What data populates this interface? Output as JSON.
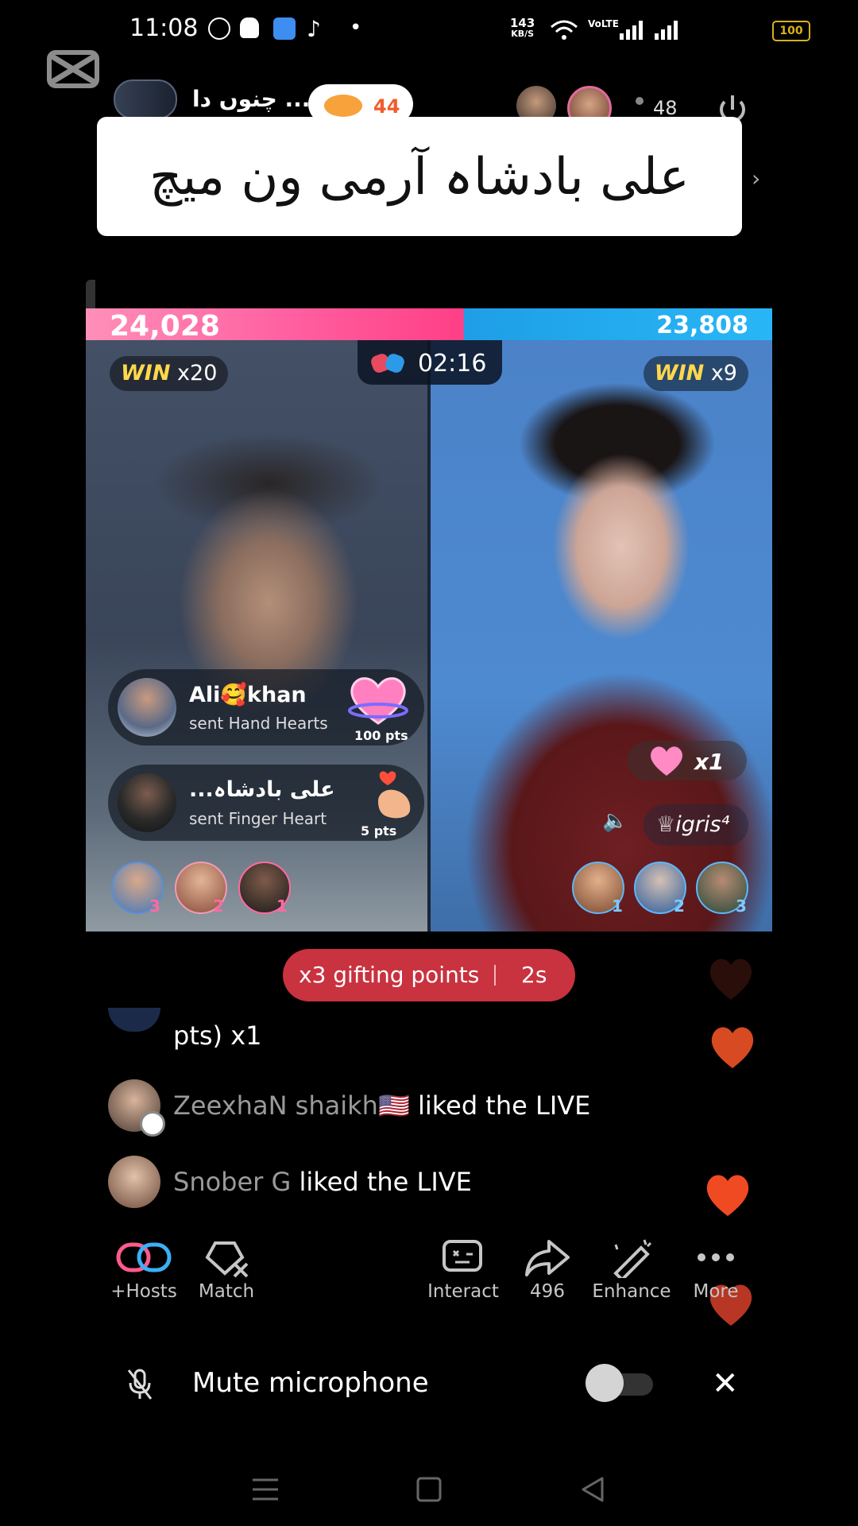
{
  "status_bar": {
    "time": "11:08",
    "net_speed_value": "143",
    "net_speed_unit": "KB/S",
    "volte": "VoLTE",
    "battery": "100",
    "dot": "•"
  },
  "header": {
    "host_name": "چنوں دا ...",
    "likes": "44",
    "viewer_count": "48"
  },
  "caption": {
    "text": "علی بادشاہ آرمی ون میچ",
    "arrow": "›"
  },
  "battle": {
    "left_score": "24,028",
    "right_score": "23,808",
    "timer": "02:16",
    "left_win_label": "WIN",
    "left_win_mult": "x20",
    "right_win_label": "WIN",
    "right_win_mult": "x9",
    "gifts": [
      {
        "user": "Ali🥰khan",
        "desc": "sent Hand Hearts",
        "pts": "100 pts"
      },
      {
        "user": "...علی بادشاہ",
        "desc": "sent Finger Heart",
        "pts": "5 pts"
      }
    ],
    "left_ranks": [
      "3",
      "2",
      "1"
    ],
    "right_ranks": [
      "1",
      "2",
      "3"
    ],
    "combo": "x1",
    "opponent_tag": "♕igris⁴"
  },
  "boost": {
    "text": "x3 gifting points",
    "time": "2s"
  },
  "chat": {
    "partial_line": "pts) x1",
    "messages": [
      {
        "user": "ZeexhaN shaikh🇺🇸",
        "text": " liked the LIVE"
      },
      {
        "user": "Snober G",
        "text": " liked the LIVE"
      }
    ]
  },
  "actions": {
    "hosts": "+Hosts",
    "match": "Match",
    "interact": "Interact",
    "share": "496",
    "enhance": "Enhance",
    "more": "More"
  },
  "mute_row": {
    "label": "Mute microphone",
    "close": "✕"
  },
  "colors": {
    "left_bar": "#ff4f8f",
    "right_bar": "#29b6f6",
    "boost_bg": "#c9323f",
    "heart": "#f04a22"
  }
}
